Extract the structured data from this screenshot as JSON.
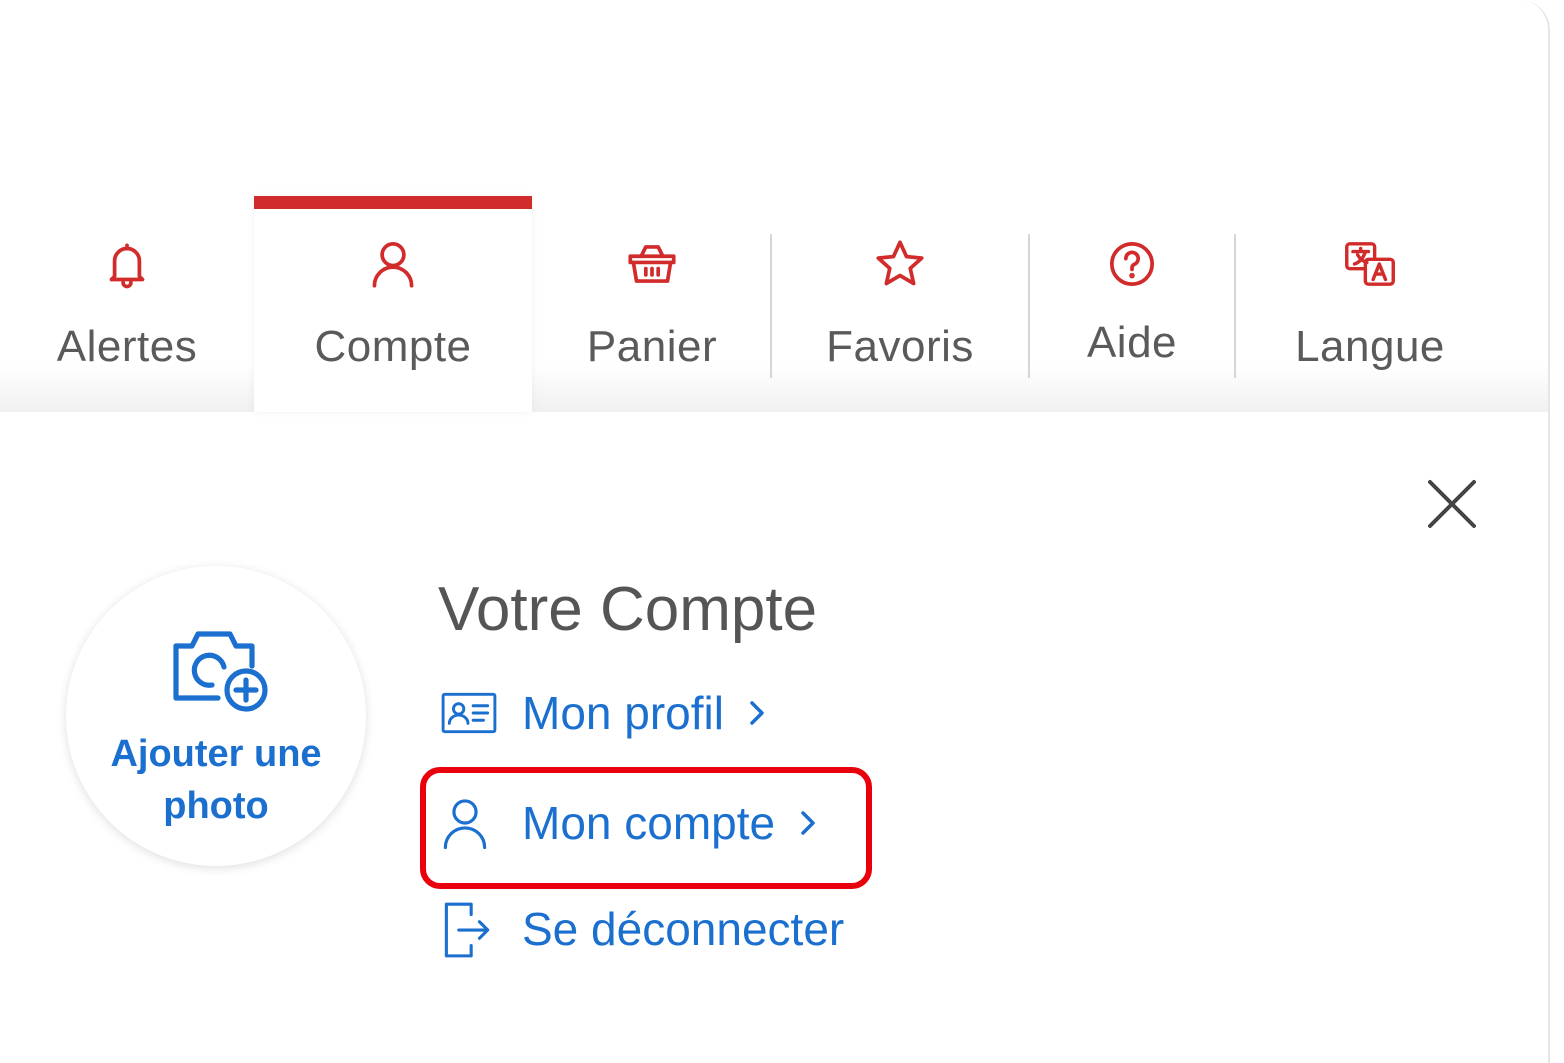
{
  "colors": {
    "accent_red": "#d22b2b",
    "link_blue": "#1b6fcf",
    "text_gray": "#5a5a5a",
    "highlight_red": "#e8000d"
  },
  "tabs": [
    {
      "label": "Alertes",
      "icon": "bell-icon",
      "active": false
    },
    {
      "label": "Compte",
      "icon": "person-icon",
      "active": true
    },
    {
      "label": "Panier",
      "icon": "basket-icon",
      "active": false
    },
    {
      "label": "Favoris",
      "icon": "star-icon",
      "active": false
    },
    {
      "label": "Aide",
      "icon": "help-circle-icon",
      "active": false
    },
    {
      "label": "Langue",
      "icon": "translate-icon",
      "active": false
    }
  ],
  "account_panel": {
    "title": "Votre Compte",
    "close_icon": "close-icon",
    "avatar": {
      "label": "Ajouter une photo",
      "icon": "add-photo-icon"
    },
    "links": [
      {
        "label": "Mon profil",
        "icon": "id-card-icon",
        "has_chevron": true
      },
      {
        "label": "Mon compte",
        "icon": "person-icon",
        "has_chevron": true,
        "highlighted": true
      },
      {
        "label": "Se déconnecter",
        "icon": "sign-out-icon",
        "has_chevron": false
      }
    ]
  }
}
